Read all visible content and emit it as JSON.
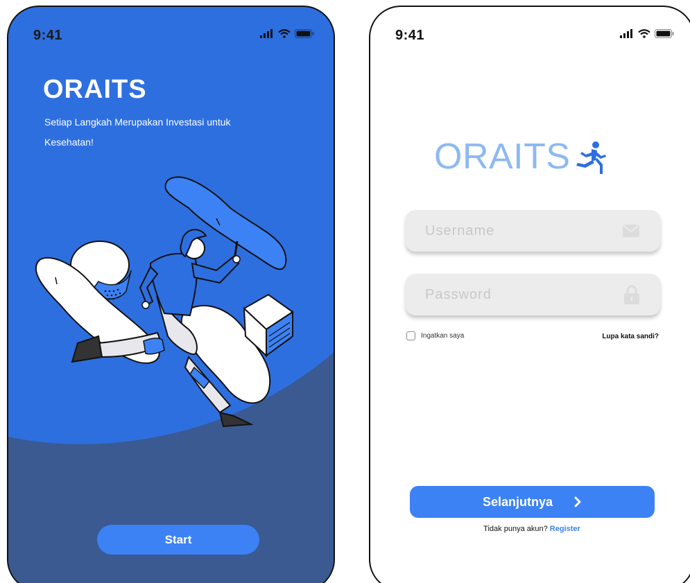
{
  "splash": {
    "status_time": "9:41",
    "brand": "ORAITS",
    "tagline": "Setiap Langkah Merupakan Investasi untuk Kesehatan!",
    "start_label": "Start",
    "icons": [
      "signal-icon",
      "wifi-icon",
      "battery-icon"
    ]
  },
  "login": {
    "status_time": "9:41",
    "brand": "ORAITS",
    "brand_icon": "runner-icon",
    "username_placeholder": "Username",
    "username_icon": "mail-icon",
    "password_placeholder": "Password",
    "password_icon": "lock-icon",
    "remember_label": "Ingatkan saya",
    "remember_checked": false,
    "forgot_label": "Lupa kata sandi?",
    "next_label": "Selanjutnya",
    "next_icon": "chevron-right-icon",
    "no_account_text": "Tidak punya akun?",
    "register_label": "Register"
  },
  "colors": {
    "primary_blue": "#2e6fdf",
    "accent_blue": "#3c82f5",
    "dark_blue": "#3a5a91",
    "logo_light_blue": "#8db9f3",
    "input_gray": "#ececec"
  }
}
